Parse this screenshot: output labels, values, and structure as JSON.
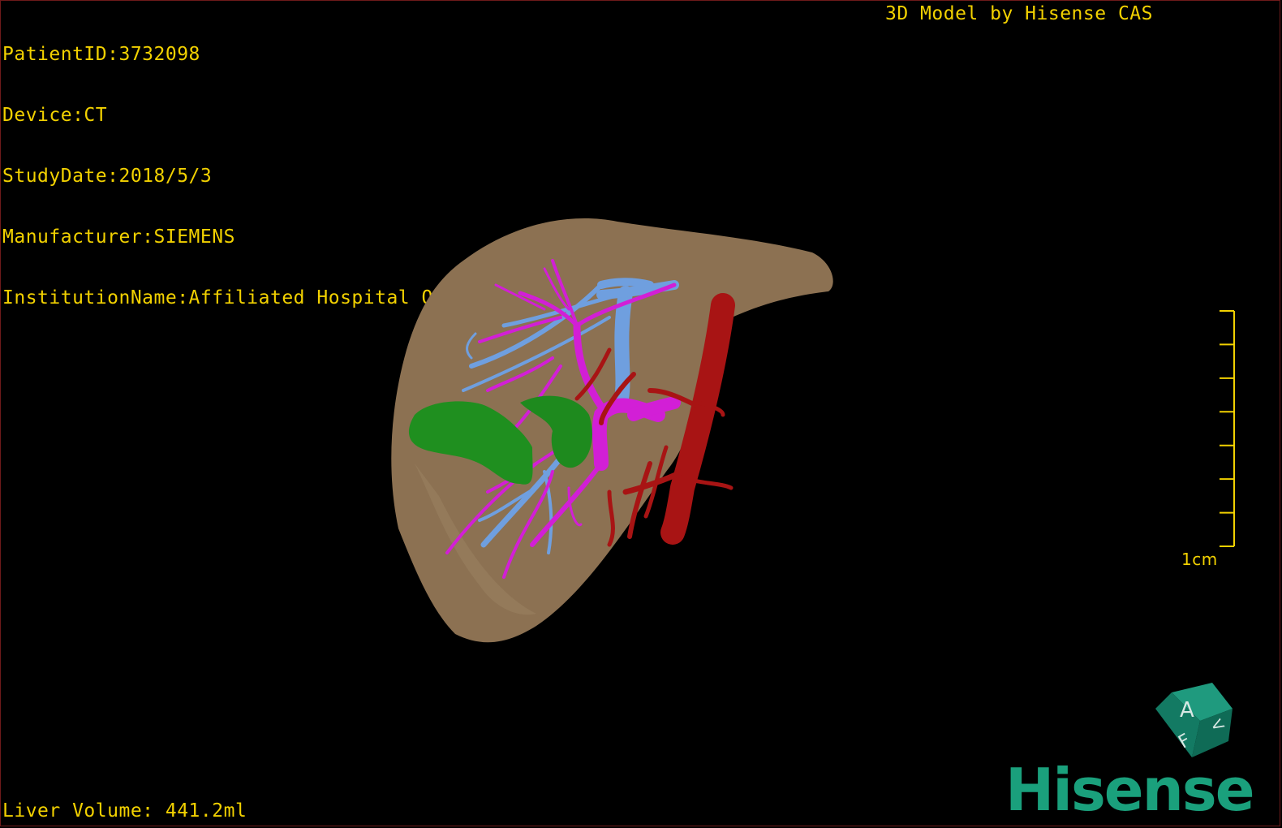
{
  "overlay": {
    "patient_id": "PatientID:3732098",
    "device": "Device:CT",
    "study_date": "StudyDate:2018/5/3",
    "manufacturer": "Manufacturer:SIEMENS",
    "institution": "InstitutionName:Affiliated Hospital Qingdao University-C",
    "model_credit": "3D Model by Hisense CAS",
    "liver_volume": "Liver Volume: 441.2ml"
  },
  "scale_bar": {
    "label": "1cm",
    "tick_count": 8
  },
  "orientation_cube": {
    "face_labels": [
      "A",
      "F",
      "V"
    ],
    "color": "#1a8f74"
  },
  "logo": {
    "text": "Hisense",
    "color": "#1aa07c"
  },
  "colors": {
    "overlay_text": "#f2d100",
    "liver": "#8c7152",
    "portal_vein": "#d21fd6",
    "hepatic_vein": "#6f9fdf",
    "artery_ivc": "#a81414",
    "gallbladder": "#1f8f1f"
  }
}
